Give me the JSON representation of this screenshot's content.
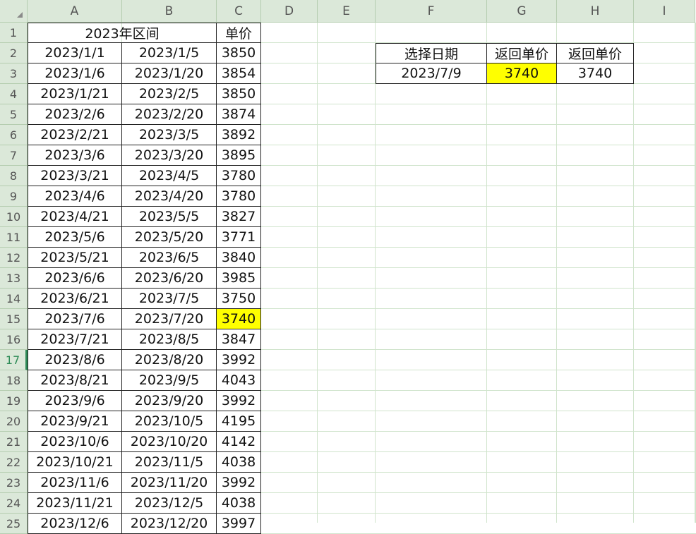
{
  "columns": [
    "A",
    "B",
    "C",
    "D",
    "E",
    "F",
    "G",
    "H",
    "I"
  ],
  "rows": [
    "1",
    "2",
    "3",
    "4",
    "5",
    "6",
    "7",
    "8",
    "9",
    "10",
    "11",
    "12",
    "13",
    "14",
    "15",
    "16",
    "17",
    "18",
    "19",
    "20",
    "21",
    "22",
    "23",
    "24",
    "25"
  ],
  "selected_row": "17",
  "header_row": {
    "range_title": "2023年区间",
    "price_title": "单价"
  },
  "price_table": [
    {
      "start": "2023/1/1",
      "end": "2023/1/5",
      "price": "3850"
    },
    {
      "start": "2023/1/6",
      "end": "2023/1/20",
      "price": "3854"
    },
    {
      "start": "2023/1/21",
      "end": "2023/2/5",
      "price": "3850"
    },
    {
      "start": "2023/2/6",
      "end": "2023/2/20",
      "price": "3874"
    },
    {
      "start": "2023/2/21",
      "end": "2023/3/5",
      "price": "3892"
    },
    {
      "start": "2023/3/6",
      "end": "2023/3/20",
      "price": "3895"
    },
    {
      "start": "2023/3/21",
      "end": "2023/4/5",
      "price": "3780"
    },
    {
      "start": "2023/4/6",
      "end": "2023/4/20",
      "price": "3780"
    },
    {
      "start": "2023/4/21",
      "end": "2023/5/5",
      "price": "3827"
    },
    {
      "start": "2023/5/6",
      "end": "2023/5/20",
      "price": "3771"
    },
    {
      "start": "2023/5/21",
      "end": "2023/6/5",
      "price": "3840"
    },
    {
      "start": "2023/6/6",
      "end": "2023/6/20",
      "price": "3985"
    },
    {
      "start": "2023/6/21",
      "end": "2023/7/5",
      "price": "3750"
    },
    {
      "start": "2023/7/6",
      "end": "2023/7/20",
      "price": "3740",
      "highlight": true
    },
    {
      "start": "2023/7/21",
      "end": "2023/8/5",
      "price": "3847"
    },
    {
      "start": "2023/8/6",
      "end": "2023/8/20",
      "price": "3992"
    },
    {
      "start": "2023/8/21",
      "end": "2023/9/5",
      "price": "4043"
    },
    {
      "start": "2023/9/6",
      "end": "2023/9/20",
      "price": "3992"
    },
    {
      "start": "2023/9/21",
      "end": "2023/10/5",
      "price": "4195"
    },
    {
      "start": "2023/10/6",
      "end": "2023/10/20",
      "price": "4142"
    },
    {
      "start": "2023/10/21",
      "end": "2023/11/5",
      "price": "4038"
    },
    {
      "start": "2023/11/6",
      "end": "2023/11/20",
      "price": "3992"
    },
    {
      "start": "2023/11/21",
      "end": "2023/12/5",
      "price": "4038"
    },
    {
      "start": "2023/12/6",
      "end": "2023/12/20",
      "price": "3997"
    }
  ],
  "lookup": {
    "headers": [
      "选择日期",
      "返回单价",
      "返回单价"
    ],
    "date": "2023/7/9",
    "result_1": "3740",
    "result_2": "3740"
  },
  "colors": {
    "highlight": "#ffff00",
    "header_bg": "#dbe8d9",
    "gridline": "#d0e4cc",
    "selected": "#2e8b57"
  }
}
